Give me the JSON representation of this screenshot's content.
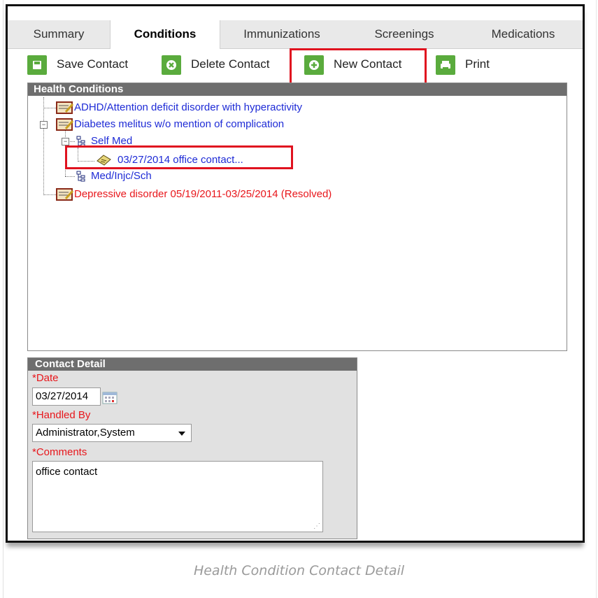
{
  "tabs": [
    {
      "label": "Summary"
    },
    {
      "label": "Conditions"
    },
    {
      "label": "Immunizations"
    },
    {
      "label": "Screenings"
    },
    {
      "label": "Medications"
    }
  ],
  "toolbar": {
    "save_label": "Save Contact",
    "delete_label": "Delete Contact",
    "new_label": "New Contact",
    "print_label": "Print"
  },
  "health_conditions": {
    "title": "Health Conditions",
    "items": [
      {
        "label": "ADHD/Attention deficit disorder with hyperactivity"
      },
      {
        "label": "Diabetes melitus w/o mention of complication"
      },
      {
        "label": "Self Med"
      },
      {
        "label": "03/27/2014 office contact..."
      },
      {
        "label": "Med/Injc/Sch"
      },
      {
        "label": "Depressive disorder 05/19/2011-03/25/2014 (Resolved)"
      }
    ]
  },
  "contact_detail": {
    "title": "Contact Detail",
    "date_label": "*Date",
    "date_value": "03/27/2014",
    "handled_by_label": "*Handled By",
    "handled_by_value": "Administrator,System",
    "comments_label": "*Comments",
    "comments_value": "office contact"
  },
  "caption": "Health Condition Contact Detail",
  "colors": {
    "accent_green": "#5aab3d",
    "highlight_red": "#e0121f",
    "link_blue": "#1e2bd6",
    "resolved_red": "#e8161b"
  }
}
